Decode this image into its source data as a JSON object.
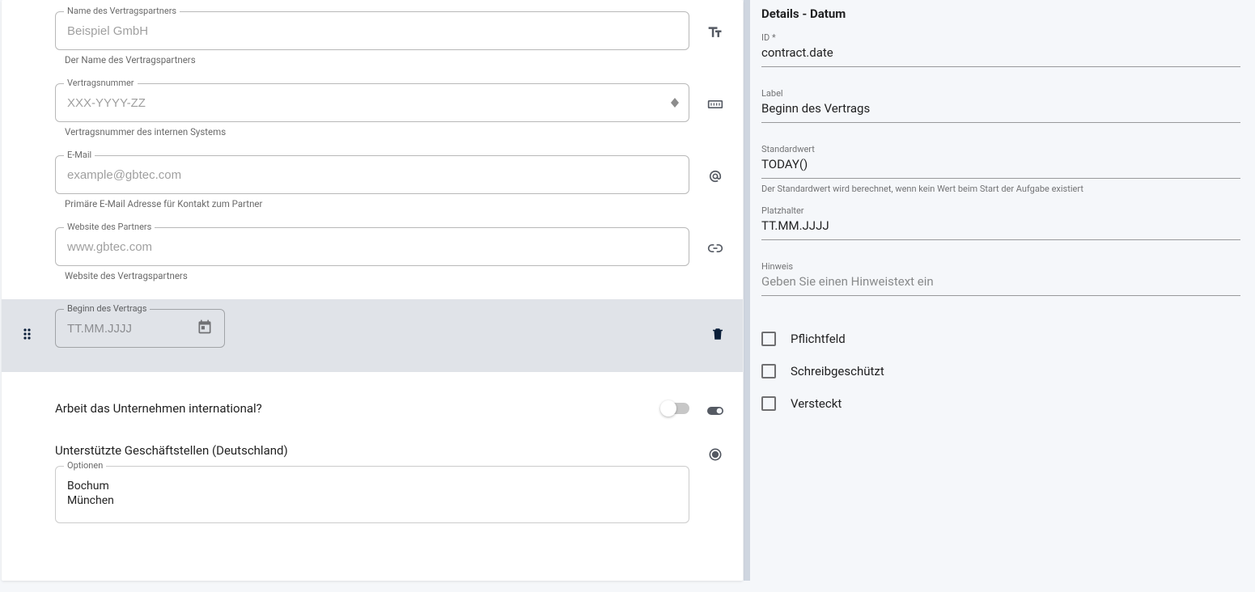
{
  "form": {
    "fields": {
      "partnerName": {
        "label": "Name des Vertragspartners",
        "placeholder": "Beispiel GmbH",
        "hint": "Der Name des Vertragspartners",
        "typeIcon": "text-size"
      },
      "contractNumber": {
        "label": "Vertragsnummer",
        "placeholder": "XXX-YYYY-ZZ",
        "hint": "Vertragsnummer des internen Systems",
        "typeIcon": "number"
      },
      "email": {
        "label": "E-Mail",
        "placeholder": "example@gbtec.com",
        "hint": "Primäre E-Mail Adresse für Kontakt zum Partner",
        "typeIcon": "at"
      },
      "website": {
        "label": "Website des Partners",
        "placeholder": "www.gbtec.com",
        "hint": "Website des Vertragspartners",
        "typeIcon": "link"
      },
      "startDate": {
        "label": "Beginn des Vertrags",
        "placeholder": "TT.MM.JJJJ"
      },
      "international": {
        "label": "Arbeit das Unternehmen international?"
      },
      "branches": {
        "label": "Unterstützte Geschäftstellen (Deutschland)",
        "optionsLabel": "Optionen",
        "options": [
          "Bochum",
          "München"
        ]
      }
    }
  },
  "details": {
    "header": "Details - Datum",
    "idLabel": "ID *",
    "idValue": "contract.date",
    "labelLabel": "Label",
    "labelValue": "Beginn des Vertrags",
    "defaultLabel": "Standardwert",
    "defaultValue": "TODAY()",
    "defaultHint": "Der Standardwert wird berechnet, wenn kein Wert beim Start der Aufgabe existiert",
    "placeholderLabel": "Platzhalter",
    "placeholderValue": "TT.MM.JJJJ",
    "hintLabel": "Hinweis",
    "hintPlaceholder": "Geben Sie einen Hinweistext ein",
    "checks": {
      "required": "Pflichtfeld",
      "readonly": "Schreibgeschützt",
      "hidden": "Versteckt"
    }
  }
}
